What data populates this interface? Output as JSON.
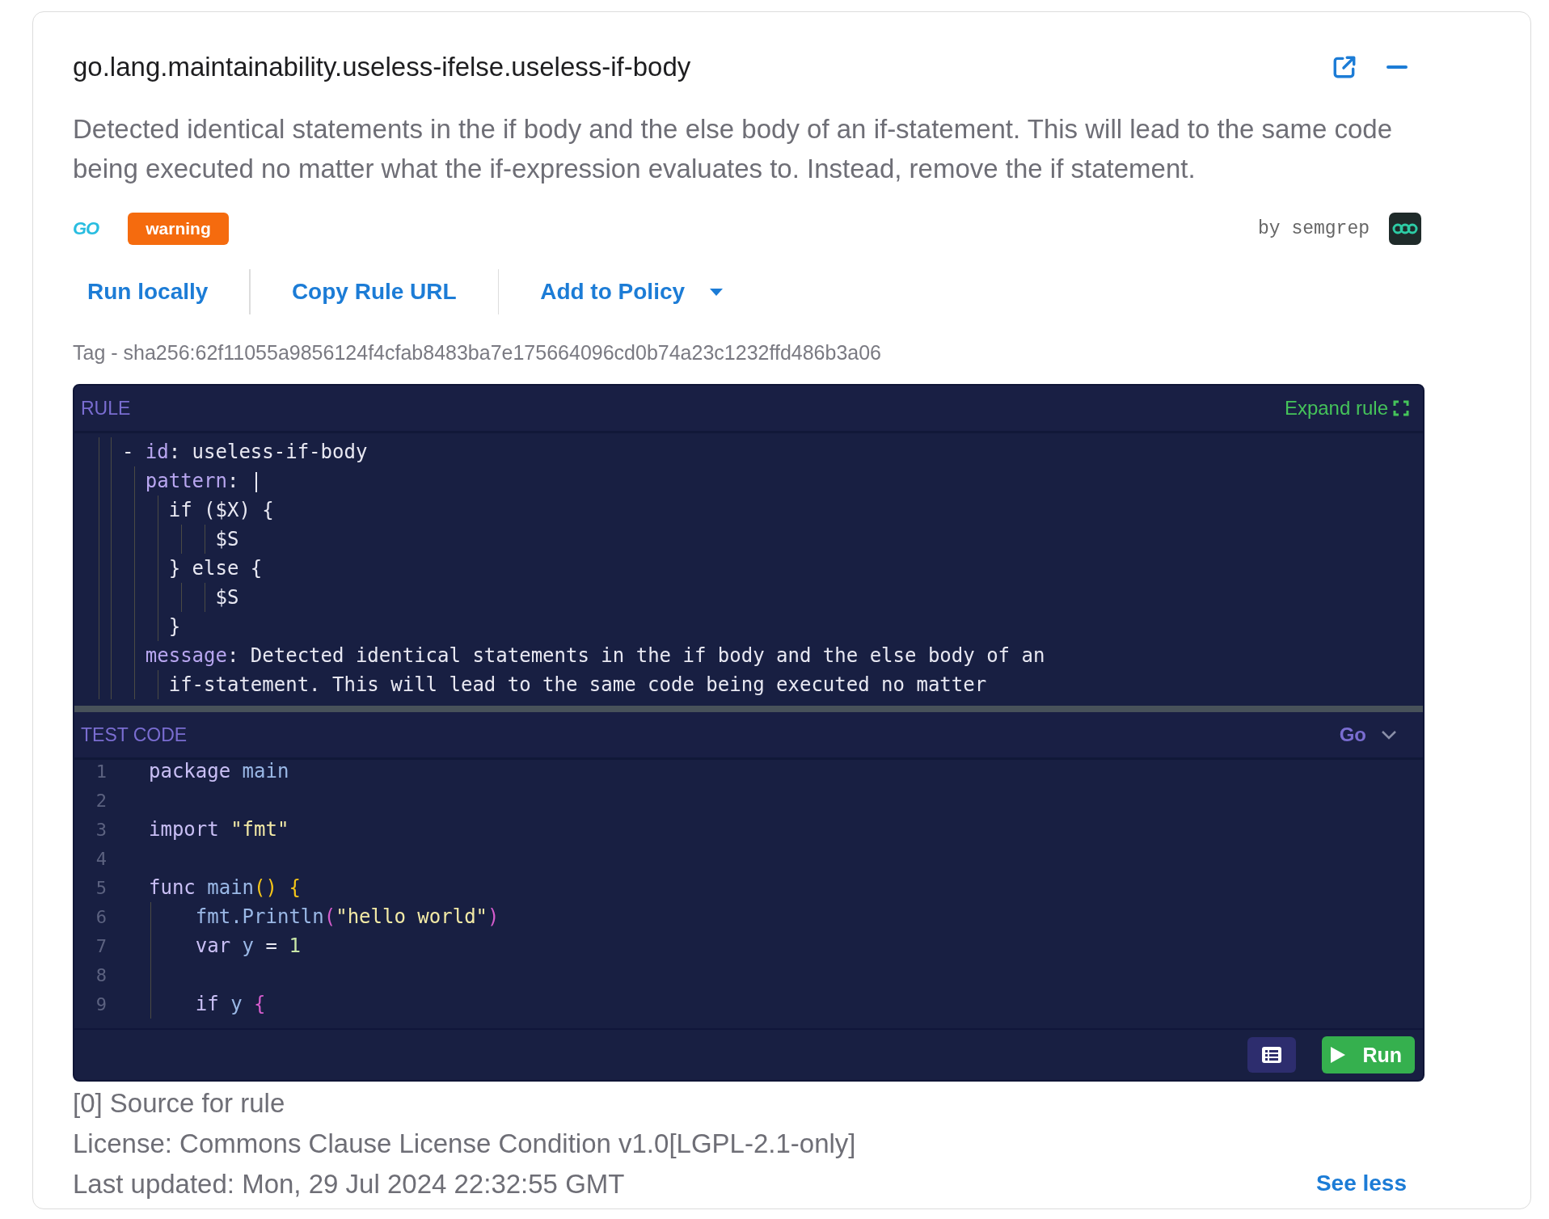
{
  "title": "go.lang.maintainability.useless-ifelse.useless-if-body",
  "description": "Detected identical statements in the if body and the else body of an if-statement. This will lead to the same code being executed no matter what the if-expression evaluates to. Instead, remove the if statement.",
  "language_logo": "GO",
  "severity": "warning",
  "author": "by semgrep",
  "actions": [
    {
      "label": "Run locally",
      "kind": "link"
    },
    {
      "label": "Copy Rule URL",
      "kind": "link"
    },
    {
      "label": "Add to Policy",
      "kind": "dropdown"
    }
  ],
  "tag": "Tag - sha256:62f11055a9856124f4cfab8483ba7e175664096cd0b74a23c1232ffd486b3a06",
  "rule_panel": {
    "title": "RULE",
    "expand": "Expand rule",
    "lines": [
      [
        {
          "t": "  - ",
          "kind": "plain"
        },
        {
          "t": "id",
          "kind": "key"
        },
        {
          "t": ": useless-if-body",
          "kind": "plain"
        }
      ],
      [
        {
          "t": "    pattern",
          "kind": "key"
        },
        {
          "t": ": |",
          "kind": "plain"
        }
      ],
      [
        {
          "t": "      if ($X) {",
          "kind": "plain"
        }
      ],
      [
        {
          "t": "          $S",
          "kind": "plain"
        }
      ],
      [
        {
          "t": "      } else {",
          "kind": "plain"
        }
      ],
      [
        {
          "t": "          $S",
          "kind": "plain"
        }
      ],
      [
        {
          "t": "      }",
          "kind": "plain"
        }
      ],
      [
        {
          "t": "    message",
          "kind": "key"
        },
        {
          "t": ": Detected identical statements in the if body and the else body of an",
          "kind": "plain"
        }
      ],
      [
        {
          "t": "      if-statement. This will lead to the same code being executed no matter",
          "kind": "plain"
        }
      ]
    ]
  },
  "test_panel": {
    "title": "TEST CODE",
    "language": "Go",
    "lines": [
      {
        "n": "1",
        "tokens": [
          {
            "t": "package",
            "kind": "keyword"
          },
          {
            "t": " main",
            "kind": "ident"
          }
        ]
      },
      {
        "n": "2"
      },
      {
        "n": "3",
        "tokens": [
          {
            "t": "import",
            "kind": "keyword"
          },
          {
            "t": " \"fmt\"",
            "kind": "string"
          }
        ]
      },
      {
        "n": "4"
      },
      {
        "n": "5",
        "tokens": [
          {
            "t": "func",
            "kind": "keyword"
          },
          {
            "t": " main",
            "kind": "ident"
          },
          {
            "t": "()",
            "kind": "paren1"
          },
          {
            "t": " {",
            "kind": "paren1"
          }
        ]
      },
      {
        "n": "6",
        "tokens": [
          {
            "t": "    fmt.Println",
            "kind": "ident"
          },
          {
            "t": "(",
            "kind": "paren2"
          },
          {
            "t": "\"hello world\"",
            "kind": "string"
          },
          {
            "t": ")",
            "kind": "paren2"
          }
        ]
      },
      {
        "n": "7",
        "tokens": [
          {
            "t": "    var",
            "kind": "keyword"
          },
          {
            "t": " y",
            "kind": "ident"
          },
          {
            "t": " = ",
            "kind": "plain"
          },
          {
            "t": "1",
            "kind": "number"
          }
        ]
      },
      {
        "n": "8"
      },
      {
        "n": "9",
        "tokens": [
          {
            "t": "    if",
            "kind": "keyword"
          },
          {
            "t": " y",
            "kind": "ident"
          },
          {
            "t": " {",
            "kind": "paren2"
          }
        ]
      }
    ],
    "run": "Run"
  },
  "footer": [
    "[0] Source for rule",
    "License: Commons Clause License Condition v1.0[LGPL-2.1-only]",
    "Last updated: Mon, 29 Jul 2024 22:32:55 GMT"
  ],
  "see_less": "See less"
}
